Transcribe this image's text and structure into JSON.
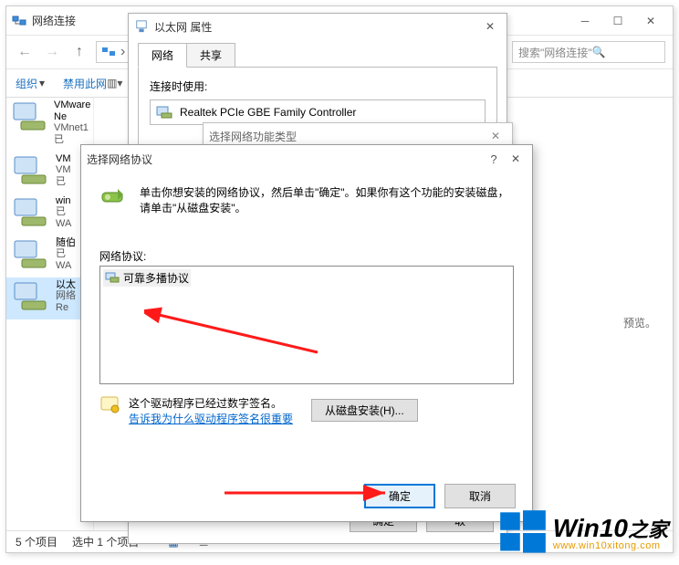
{
  "main_window": {
    "title": "网络连接",
    "search_placeholder": "搜索\"网络连接\"",
    "toolbar": {
      "organize": "组织",
      "disable": "禁用此网"
    },
    "items": [
      {
        "t1": "VMware Ne",
        "t2": "VMnet1",
        "t3": "已"
      },
      {
        "t1": "VM",
        "t2": "VM",
        "t3": "已"
      },
      {
        "t1": "win",
        "t2": "已",
        "t3": "WA"
      },
      {
        "t1": "随伯",
        "t2": "已",
        "t3": "WA"
      },
      {
        "t1": "以太",
        "t2": "网络",
        "t3": "Re"
      }
    ],
    "status": {
      "count": "5 个项目",
      "selected": "选中 1 个项目"
    },
    "preview_hint": "预览。"
  },
  "eth_dialog": {
    "title": "以太网 属性",
    "tabs": {
      "network": "网络",
      "sharing": "共享"
    },
    "conn_label": "连接时使用:",
    "adapter": "Realtek PCIe GBE Family Controller",
    "buttons": {
      "ok": "确定",
      "cancel": "取"
    }
  },
  "feature_dialog": {
    "title": "选择网络功能类型"
  },
  "protocol_dialog": {
    "title": "选择网络协议",
    "help_q": "?",
    "instr1": "单击你想安装的网络协议，然后单击\"确定\"。如果你有这个功能的安装磁盘，请单击\"从磁盘安装\"。",
    "list_label": "网络协议:",
    "list_item": "可靠多播协议",
    "signed": "这个驱动程序已经过数字签名。",
    "why_link": "告诉我为什么驱动程序签名很重要",
    "from_disk": "从磁盘安装(H)...",
    "ok": "确定",
    "cancel": "取消"
  },
  "watermark": {
    "brand": "Win10",
    "suffix": "之家",
    "url": "www.win10xitong.com"
  }
}
